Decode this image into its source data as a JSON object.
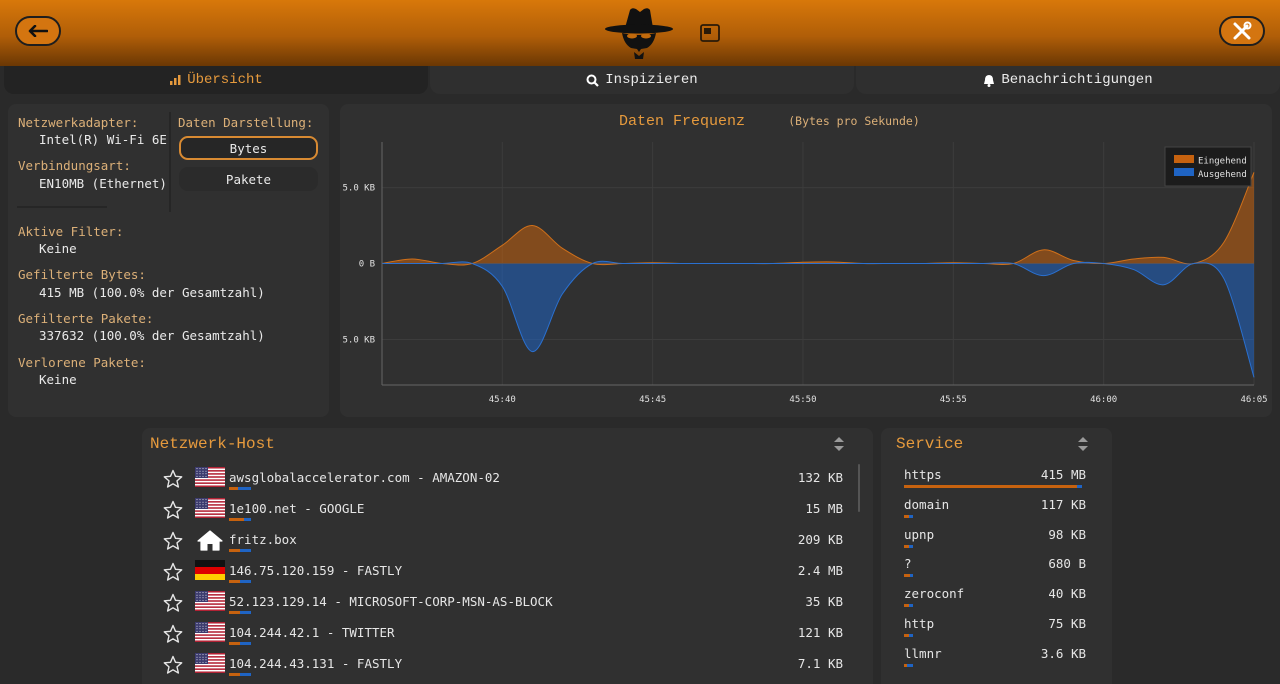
{
  "colors": {
    "accent": "#d8780a",
    "incoming": "#c6620f",
    "outgoing": "#1f64c4",
    "label": "#dcb078"
  },
  "toolbar": {
    "back_icon": "arrow-left-icon",
    "settings_icon": "tools-icon",
    "logo_icon": "spy-hat-logo",
    "pip_icon": "picture-in-picture-icon"
  },
  "tabs": [
    {
      "label": "Übersicht",
      "icon": "chart-icon"
    },
    {
      "label": "Inspizieren",
      "icon": "magnifier-icon"
    },
    {
      "label": "Benachrichtigungen",
      "icon": "bell-icon"
    }
  ],
  "adapter": {
    "adapter_label": "Netzwerkadapter:",
    "adapter_value": "Intel(R) Wi-Fi 6E",
    "conn_label": "Verbindungsart:",
    "conn_value": "EN10MB (Ethernet)",
    "display_label": "Daten Darstellung:",
    "bytes_btn": "Bytes",
    "packets_btn": "Pakete"
  },
  "stats": {
    "filter_label": "Aktive Filter:",
    "filter_value": "Keine",
    "bytes_label": "Gefilterte Bytes:",
    "bytes_value": "415 MB (100.0% der Gesamtzahl)",
    "packets_label": "Gefilterte Pakete:",
    "packets_value": "337632 (100.0% der Gesamtzahl)",
    "lost_label": "Verlorene Pakete:",
    "lost_value": "Keine"
  },
  "chart_data": {
    "type": "area",
    "title": "Daten Frequenz",
    "subtitle": "(Bytes pro Sekunde)",
    "y_tick_labels": [
      "5.0 KB",
      "0 B",
      "5.0 KB"
    ],
    "x_tick_labels": [
      "45:40",
      "45:45",
      "45:50",
      "45:55",
      "46:00",
      "46:05"
    ],
    "x": [
      36,
      37,
      38,
      39,
      40,
      41,
      42,
      43,
      44,
      45,
      46,
      47,
      48,
      49,
      50,
      51,
      52,
      53,
      54,
      55,
      56,
      57,
      58,
      59,
      60,
      61,
      62,
      63,
      64,
      65
    ],
    "series": [
      {
        "name": "Eingehend",
        "values": [
          0,
          0.3,
          0,
          0,
          1.2,
          2.5,
          1.0,
          0,
          0,
          0.05,
          0,
          0,
          0,
          0,
          0.08,
          0.1,
          0,
          0,
          0,
          0.05,
          0,
          0,
          0.9,
          0.2,
          0,
          0.3,
          0.4,
          0,
          1.4,
          6.0
        ]
      },
      {
        "name": "Ausgehend",
        "values": [
          0,
          0,
          0,
          0,
          -1.5,
          -5.8,
          -2.0,
          0,
          0,
          0,
          0,
          0,
          0,
          0,
          0,
          0,
          0,
          0,
          0,
          0,
          0,
          0,
          -0.8,
          0,
          0,
          -0.4,
          -1.4,
          0,
          -1.0,
          -7.5
        ]
      }
    ],
    "ylim": [
      -8,
      8
    ],
    "legend_position": "top-right",
    "grid": true
  },
  "hosts": {
    "title": "Netzwerk-Host",
    "sort_icon": "sort-icon",
    "rows": [
      {
        "name": "awsglobalaccelerator.com - AMAZON-02",
        "size": "132 KB",
        "flag": "us",
        "in": 0.4,
        "out": 0.6
      },
      {
        "name": "1e100.net - GOOGLE",
        "size": "15 MB",
        "flag": "us",
        "in": 0.7,
        "out": 0.3
      },
      {
        "name": "fritz.box",
        "size": "209 KB",
        "flag": "home",
        "in": 0.5,
        "out": 0.5
      },
      {
        "name": "146.75.120.159 - FASTLY",
        "size": "2.4 MB",
        "flag": "de",
        "in": 0.5,
        "out": 0.5
      },
      {
        "name": "52.123.129.14 - MICROSOFT-CORP-MSN-AS-BLOCK",
        "size": "35 KB",
        "flag": "us",
        "in": 0.5,
        "out": 0.5
      },
      {
        "name": "104.244.42.1 - TWITTER",
        "size": "121 KB",
        "flag": "us",
        "in": 0.5,
        "out": 0.5
      },
      {
        "name": "104.244.43.131 - FASTLY",
        "size": "7.1 KB",
        "flag": "us",
        "in": 0.5,
        "out": 0.5
      }
    ]
  },
  "services": {
    "title": "Service",
    "sort_icon": "sort-icon",
    "rows": [
      {
        "name": "https",
        "size": "415 MB",
        "in": 0.97,
        "out": 0.03,
        "share": 1.0
      },
      {
        "name": "domain",
        "size": "117 KB",
        "in": 0.5,
        "out": 0.5,
        "share": 0.05
      },
      {
        "name": "upnp",
        "size": "98 KB",
        "in": 0.5,
        "out": 0.5,
        "share": 0.05
      },
      {
        "name": "?",
        "size": "680 B",
        "in": 0.7,
        "out": 0.3,
        "share": 0.05
      },
      {
        "name": "zeroconf",
        "size": "40 KB",
        "in": 0.5,
        "out": 0.5,
        "share": 0.05
      },
      {
        "name": "http",
        "size": "75 KB",
        "in": 0.5,
        "out": 0.5,
        "share": 0.05
      },
      {
        "name": "llmnr",
        "size": "3.6 KB",
        "in": 0.3,
        "out": 0.7,
        "share": 0.05
      }
    ]
  }
}
